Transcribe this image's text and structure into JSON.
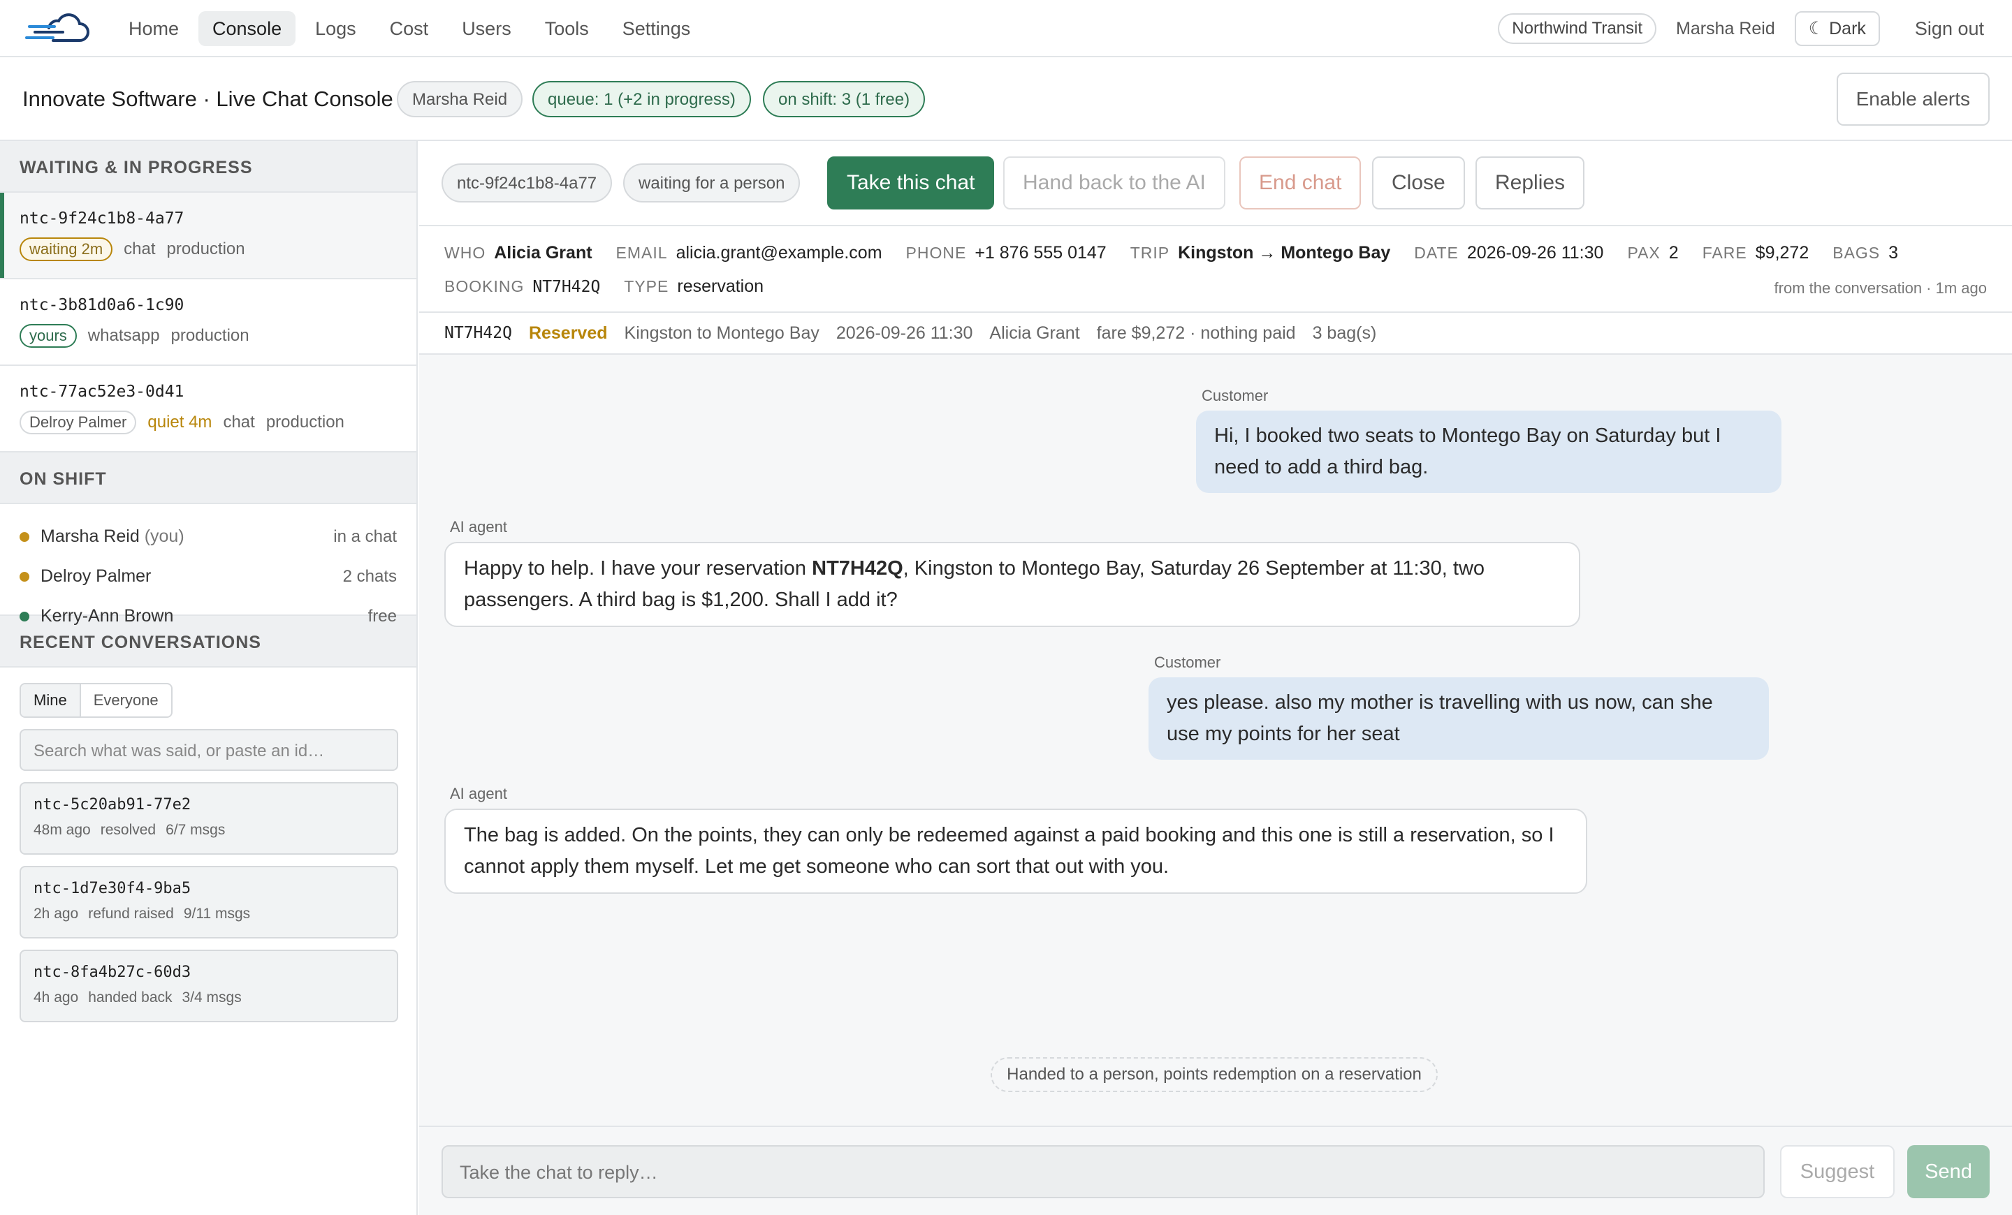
{
  "nav": {
    "items": [
      "Home",
      "Console",
      "Logs",
      "Cost",
      "Users",
      "Tools",
      "Settings"
    ],
    "active": "Console",
    "org": "Northwind Transit",
    "user": "Marsha Reid",
    "dark_label": "☾ Dark",
    "signout": "Sign out"
  },
  "subheader": {
    "title": "Innovate Software · Live Chat Console",
    "agent_pill": "Marsha Reid",
    "queue_pill": "queue: 1 (+2 in progress)",
    "shift_pill": "on shift: 3 (1 free)",
    "enable_alerts": "Enable alerts"
  },
  "sidebar": {
    "waiting_heading": "WAITING & IN PROGRESS",
    "conversations": [
      {
        "id": "ntc-9f24c1b8-4a77",
        "tag": "waiting 2m",
        "channel": "chat",
        "env": "production"
      },
      {
        "id": "ntc-3b81d0a6-1c90",
        "tag": "yours",
        "channel": "whatsapp",
        "env": "production"
      },
      {
        "id": "ntc-77ac52e3-0d41",
        "tag": "Delroy Palmer",
        "quiet": "quiet 4m",
        "channel": "chat",
        "env": "production"
      }
    ],
    "shift_heading": "ON SHIFT",
    "shift": [
      {
        "name": "Marsha Reid",
        "you": "(you)",
        "status": "in a chat",
        "color": "#c4901a"
      },
      {
        "name": "Delroy Palmer",
        "you": "",
        "status": "2 chats",
        "color": "#c4901a"
      },
      {
        "name": "Kerry-Ann Brown",
        "you": "",
        "status": "free",
        "color": "#2e7d56"
      }
    ],
    "recent_heading": "RECENT CONVERSATIONS",
    "filter": {
      "mine": "Mine",
      "everyone": "Everyone"
    },
    "search_placeholder": "Search what was said, or paste an id…",
    "recent": [
      {
        "id": "ntc-5c20ab91-77e2",
        "age": "48m ago",
        "state": "resolved",
        "msgs": "6/7 msgs"
      },
      {
        "id": "ntc-1d7e30f4-9ba5",
        "age": "2h ago",
        "state": "refund raised",
        "msgs": "9/11 msgs"
      },
      {
        "id": "ntc-8fa4b27c-60d3",
        "age": "4h ago",
        "state": "handed back",
        "msgs": "3/4 msgs"
      }
    ]
  },
  "toolbar": {
    "conv_id": "ntc-9f24c1b8-4a77",
    "status": "waiting for a person",
    "take": "Take this chat",
    "handback": "Hand back to the AI",
    "end": "End chat",
    "close": "Close",
    "replies": "Replies"
  },
  "customer": {
    "who_k": "WHO",
    "who": "Alicia Grant",
    "email_k": "EMAIL",
    "email": "alicia.grant@example.com",
    "phone_k": "PHONE",
    "phone": "+1 876 555 0147",
    "trip_k": "TRIP",
    "trip": "Kingston → Montego Bay",
    "date_k": "DATE",
    "date": "2026-09-26 11:30",
    "pax_k": "PAX",
    "pax": "2",
    "fare_k": "FARE",
    "fare": "$9,272",
    "bags_k": "BAGS",
    "bags": "3",
    "booking_k": "BOOKING",
    "booking": "NT7H42Q",
    "type_k": "TYPE",
    "type": "reservation",
    "source_note": "from the conversation · 1m ago"
  },
  "booking": {
    "code": "NT7H42Q",
    "status": "Reserved",
    "route": "Kingston to Montego Bay",
    "datetime": "2026-09-26 11:30",
    "name": "Alicia Grant",
    "fare": "fare $9,272 · nothing paid",
    "bags": "3 bag(s)"
  },
  "messages": [
    {
      "who": "Customer",
      "text": "Hi, I booked two seats to Montego Bay on Saturday but I need to add a third bag."
    },
    {
      "who": "AI agent",
      "pre": "Happy to help. I have your reservation ",
      "strong": "NT7H42Q",
      "post": ", Kingston to Montego Bay, Saturday 26 September at 11:30, two passengers. A third bag is $1,200. Shall I add it?"
    },
    {
      "who": "Customer",
      "text": "yes please. also my mother is travelling with us now, can she use my points for her seat"
    },
    {
      "who": "AI agent",
      "text": "The bag is added. On the points, they can only be redeemed against a paid booking and this one is still a reservation, so I cannot apply them myself. Let me get someone who can sort that out with you."
    }
  ],
  "handoff_note": "Handed to a person, points redemption on a reservation",
  "composer": {
    "placeholder": "Take the chat to reply…",
    "suggest": "Suggest",
    "send": "Send"
  }
}
